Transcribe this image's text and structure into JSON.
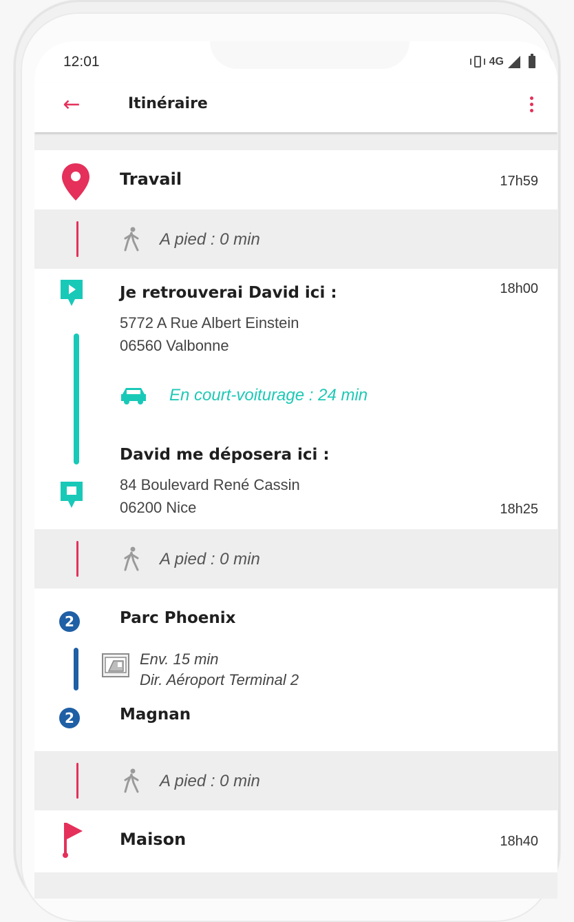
{
  "status_bar": {
    "time": "12:01",
    "network": "4G"
  },
  "app_bar": {
    "back_icon": "arrow-left-icon",
    "title": "Itinéraire",
    "menu_icon": "more-vertical-icon"
  },
  "colors": {
    "accent": "#e4305a",
    "carpool": "#19c9b8",
    "transit": "#1f5fa5"
  },
  "itinerary": {
    "start": {
      "name": "Travail",
      "time": "17h59",
      "icon": "map-pin-icon"
    },
    "walk1": {
      "text": "A pied : 0 min",
      "icon": "walking-person-icon"
    },
    "pickup": {
      "title": "Je retrouverai David ici :",
      "time": "18h00",
      "address_line1": "5772 A Rue Albert Einstein",
      "address_line2": "06560 Valbonne",
      "icon": "play-flag-icon"
    },
    "carpool": {
      "text": "En court-voiturage : 24 min",
      "icon": "car-icon"
    },
    "dropoff": {
      "title": "David me déposera ici :",
      "address_line1": "84 Boulevard René Cassin",
      "address_line2": "06200 Nice",
      "time": "18h25",
      "icon": "stop-flag-icon"
    },
    "walk2": {
      "text": "A pied : 0 min",
      "icon": "walking-person-icon"
    },
    "transit": {
      "line": "2",
      "from": "Parc Phoenix",
      "duration": "Env. 15 min",
      "direction": "Dir. Aéroport Terminal 2",
      "to": "Magnan",
      "icon": "tram-icon"
    },
    "walk3": {
      "text": "A pied : 0 min",
      "icon": "walking-person-icon"
    },
    "end": {
      "name": "Maison",
      "time": "18h40",
      "icon": "finish-flag-icon"
    }
  }
}
